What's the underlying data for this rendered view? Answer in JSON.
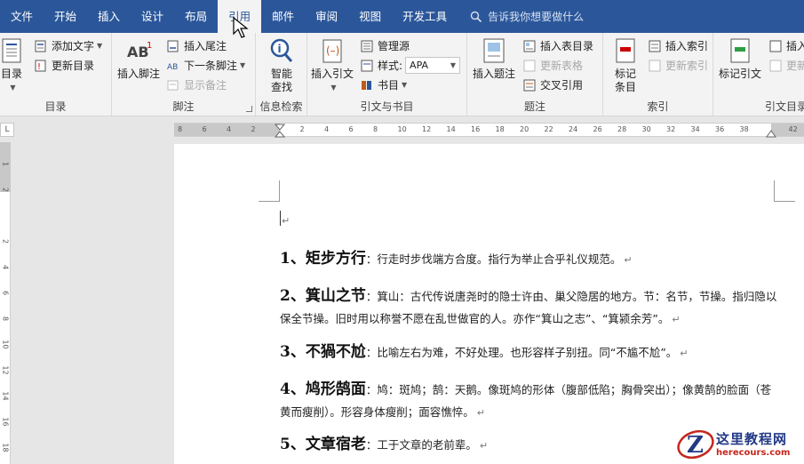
{
  "tabs": [
    {
      "label": "文件",
      "active": false
    },
    {
      "label": "开始",
      "active": false
    },
    {
      "label": "插入",
      "active": false
    },
    {
      "label": "设计",
      "active": false
    },
    {
      "label": "布局",
      "active": false
    },
    {
      "label": "引用",
      "active": true
    },
    {
      "label": "邮件",
      "active": false
    },
    {
      "label": "审阅",
      "active": false
    },
    {
      "label": "视图",
      "active": false
    },
    {
      "label": "开发工具",
      "active": false
    }
  ],
  "tell_me": {
    "placeholder": "告诉我你想要做什么",
    "icon": "lightbulb-icon"
  },
  "ribbon": {
    "toc": {
      "big_label": "目录",
      "add_text": "添加文字",
      "update_toc": "更新目录",
      "group_label": "目录"
    },
    "footnotes": {
      "insert_footnote": "插入脚注",
      "insert_endnote": "插入尾注",
      "next_footnote": "下一条脚注",
      "show_notes": "显示备注",
      "group_label": "脚注"
    },
    "research": {
      "smart_lookup_line1": "智能",
      "smart_lookup_line2": "查找",
      "group_label": "信息检索"
    },
    "citations": {
      "insert_citation": "插入引文",
      "manage_sources": "管理源",
      "style_label": "样式:",
      "style_value": "APA",
      "bibliography": "书目",
      "group_label": "引文与书目"
    },
    "captions": {
      "insert_caption": "插入题注",
      "insert_table_of_figures": "插入表目录",
      "update_table": "更新表格",
      "cross_reference": "交叉引用",
      "group_label": "题注"
    },
    "index": {
      "mark_entry_line1": "标记",
      "mark_entry_line2": "条目",
      "insert_index": "插入索引",
      "update_index": "更新索引",
      "group_label": "索引"
    },
    "toa": {
      "mark_citation": "标记引文",
      "insert_toa": "插入",
      "update_toa": "更新",
      "group_label": "引文目录"
    }
  },
  "rulers": {
    "corner": "L",
    "horizontal_ticks": [
      "8",
      "6",
      "4",
      "2",
      "",
      "2",
      "4",
      "6",
      "8",
      "10",
      "12",
      "14",
      "16",
      "18",
      "20",
      "22",
      "24",
      "26",
      "28",
      "30",
      "32",
      "34",
      "36",
      "38",
      "",
      "42"
    ],
    "vertical_ticks": [
      "1",
      "2",
      "",
      "2",
      "4",
      "6",
      "8",
      "10",
      "12",
      "14",
      "16",
      "18"
    ]
  },
  "document": {
    "paragraphs": [
      {
        "heading": "1、矩步方行",
        "body": "：行走时步伐端方合度。指行为举止合乎礼仪规范。",
        "mark": "↵"
      },
      {
        "heading": "2、箕山之节",
        "body": "：箕山：古代传说唐尧时的隐士许由、巢父隐居的地方。节：名节，节操。指归隐以保全节操。旧时用以称誉不愿在乱世做官的人。亦作“箕山之志”、“箕颍余芳”。",
        "mark": "↵"
      },
      {
        "heading": "3、不猧不尬",
        "body": "：比喻左右为难，不好处理。也形容样子别扭。同“不尴不尬”。",
        "mark": "↵"
      },
      {
        "heading": "4、鸠形鹄面",
        "body": "：鸠：斑鸠；鹄：天鹅。像斑鸠的形体（腹部低陷；胸骨突出）；像黄鹄的脸面（苍黄而瘦削）。形容身体瘦削；面容憔悴。",
        "mark": "↵"
      },
      {
        "heading": "5、文章宿老",
        "body": "：工于文章的老前辈。",
        "mark": "↵"
      }
    ],
    "empty_line_mark": "↵"
  },
  "watermark": {
    "name": "这里教程网",
    "url": "herecours.com",
    "logo_letter": "Z"
  },
  "colors": {
    "accent": "#2b579a",
    "ribbon_bg": "#f3f3f3",
    "page_bg": "#ffffff",
    "watermark_blue": "#223a86",
    "watermark_red": "#c5261c"
  }
}
